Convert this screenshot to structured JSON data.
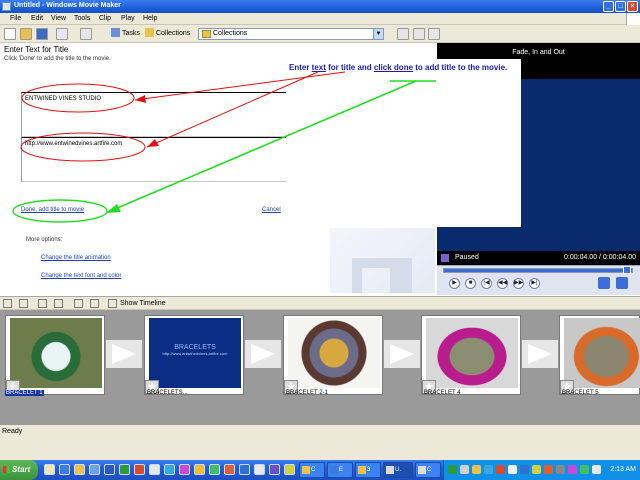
{
  "window": {
    "title": "Untitled - Windows Movie Maker",
    "buttons": {
      "minimize": "_",
      "maximize": "□",
      "close": "×"
    }
  },
  "menu": [
    "File",
    "Edit",
    "View",
    "Tools",
    "Clip",
    "Play",
    "Help"
  ],
  "toolbar": {
    "tasks_label": "Tasks",
    "collections_label": "Collections",
    "collections_select": "Collections"
  },
  "task_pane": {
    "heading": "Enter Text for Title",
    "subheading": "Click 'Done' to add the title to the movie.",
    "title_text": "ENTWINED VINES STUDIO",
    "subtitle_text": "http://www.entwinedvines.artfire.com",
    "done_link": "Done, add title to movie",
    "cancel_link": "Cancel",
    "more_options_label": "More options:",
    "option_animation": "Change the title animation",
    "option_font": "Change the text font and color"
  },
  "callout": {
    "part1": "Enter ",
    "part2": "text",
    "part3": " for title and ",
    "part4": "click done",
    "part5": " to add title to the movie."
  },
  "preview": {
    "title": "Fade, In and Out",
    "status": "Paused",
    "time": "0:00:04.00 / 0:00:04.00",
    "progress": 1.0
  },
  "storyboard": {
    "show_timeline": "Show Timeline",
    "clips": [
      {
        "label": "BRACELET 1"
      },
      {
        "label": "BRACELETS..."
      },
      {
        "label": "BRACELET 2-1"
      },
      {
        "label": "BRACELET 4"
      },
      {
        "label": "BRACELET 5"
      }
    ],
    "clip2_thumb_text": "BRACELETS",
    "clip2_thumb_url": "http://www.entwinedvines.artfire.com"
  },
  "status": {
    "text": "Ready"
  },
  "taskbar": {
    "start": "Start",
    "tasks": [
      "C",
      "E",
      "3",
      "U.",
      "C"
    ],
    "clock": "2:13 AM"
  },
  "colors": {
    "annotation_red": "#e01010",
    "annotation_green": "#22dd22",
    "callout_blue": "#1b1bb8"
  }
}
